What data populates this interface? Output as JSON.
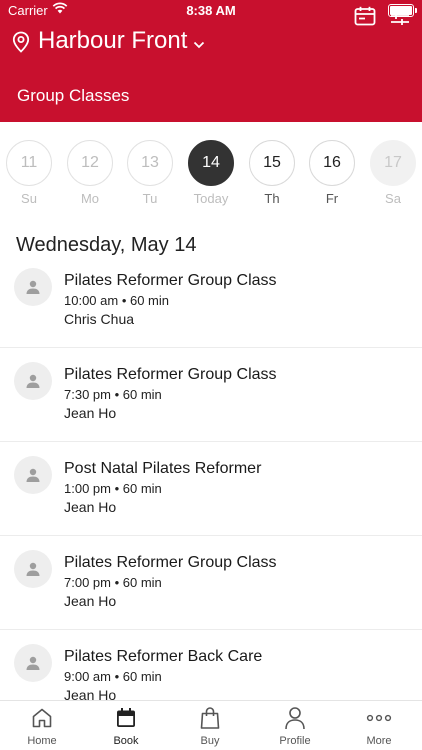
{
  "status_bar": {
    "carrier": "Carrier",
    "time": "8:38 AM"
  },
  "header": {
    "location": "Harbour Front",
    "section_title": "Group Classes"
  },
  "days": [
    {
      "num": "11",
      "label": "Su",
      "state": "past"
    },
    {
      "num": "12",
      "label": "Mo",
      "state": "past"
    },
    {
      "num": "13",
      "label": "Tu",
      "state": "past"
    },
    {
      "num": "14",
      "label": "Today",
      "state": "selected"
    },
    {
      "num": "15",
      "label": "Th",
      "state": "active"
    },
    {
      "num": "16",
      "label": "Fr",
      "state": "active"
    },
    {
      "num": "17",
      "label": "Sa",
      "state": "muted"
    }
  ],
  "date_heading": "Wednesday, May 14",
  "classes": [
    {
      "name": "Pilates Reformer Group Class",
      "time": "10:00 am • 60 min",
      "instructor": "Chris Chua"
    },
    {
      "name": "Pilates Reformer Group Class",
      "time": "7:30 pm • 60 min",
      "instructor": "Jean Ho"
    },
    {
      "name": "Post Natal Pilates Reformer",
      "time": "1:00 pm • 60 min",
      "instructor": "Jean Ho"
    },
    {
      "name": "Pilates Reformer Group Class",
      "time": "7:00 pm • 60 min",
      "instructor": "Jean Ho"
    },
    {
      "name": "Pilates Reformer Back Care",
      "time": "9:00 am • 60 min",
      "instructor": "Jean Ho"
    }
  ],
  "tabs": [
    {
      "label": "Home",
      "icon": "home-icon"
    },
    {
      "label": "Book",
      "icon": "calendar-icon",
      "active": true
    },
    {
      "label": "Buy",
      "icon": "bag-icon"
    },
    {
      "label": "Profile",
      "icon": "person-icon"
    },
    {
      "label": "More",
      "icon": "more-icon"
    }
  ],
  "colors": {
    "brand": "#c8102e",
    "selected_day": "#333333"
  }
}
